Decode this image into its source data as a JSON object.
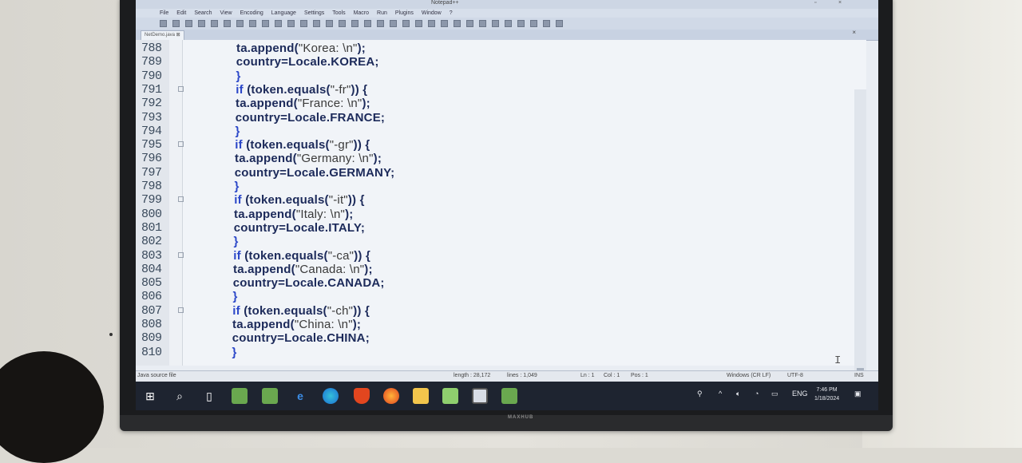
{
  "window": {
    "title": "Notepad++",
    "tab_label": "NetDemo.java",
    "restore_btn": "▫",
    "close_btn": "×"
  },
  "menu": [
    "File",
    "Edit",
    "Search",
    "View",
    "Encoding",
    "Language",
    "Settings",
    "Tools",
    "Macro",
    "Run",
    "Plugins",
    "Window",
    "?"
  ],
  "editor": {
    "lines": [
      {
        "n": "788",
        "code": [
          {
            "t": "ta.append(",
            "c": "p"
          },
          {
            "t": "\"Korea: \\n\"",
            "c": "s"
          },
          {
            "t": ");",
            "c": "p"
          }
        ]
      },
      {
        "n": "789",
        "code": [
          {
            "t": "country=Locale.KOREA;",
            "c": "p"
          }
        ]
      },
      {
        "n": "790",
        "code": [
          {
            "t": "}",
            "c": "k"
          }
        ]
      },
      {
        "n": "791",
        "code": [
          {
            "t": "if",
            "c": "k"
          },
          {
            "t": " (token.equals(",
            "c": "p"
          },
          {
            "t": "\"-fr\"",
            "c": "s"
          },
          {
            "t": ")) {",
            "c": "p"
          }
        ]
      },
      {
        "n": "792",
        "code": [
          {
            "t": "ta.append(",
            "c": "p"
          },
          {
            "t": "\"France: \\n\"",
            "c": "s"
          },
          {
            "t": ");",
            "c": "p"
          }
        ]
      },
      {
        "n": "793",
        "code": [
          {
            "t": "country=Locale.FRANCE;",
            "c": "p"
          }
        ]
      },
      {
        "n": "794",
        "code": [
          {
            "t": "}",
            "c": "k"
          }
        ]
      },
      {
        "n": "795",
        "code": [
          {
            "t": "if",
            "c": "k"
          },
          {
            "t": " (token.equals(",
            "c": "p"
          },
          {
            "t": "\"-gr\"",
            "c": "s"
          },
          {
            "t": ")) {",
            "c": "p"
          }
        ]
      },
      {
        "n": "796",
        "code": [
          {
            "t": "ta.append(",
            "c": "p"
          },
          {
            "t": "\"Germany: \\n\"",
            "c": "s"
          },
          {
            "t": ");",
            "c": "p"
          }
        ]
      },
      {
        "n": "797",
        "code": [
          {
            "t": "country=Locale.GERMANY;",
            "c": "p"
          }
        ]
      },
      {
        "n": "798",
        "code": [
          {
            "t": "}",
            "c": "k"
          }
        ]
      },
      {
        "n": "799",
        "code": [
          {
            "t": "if",
            "c": "k"
          },
          {
            "t": " (token.equals(",
            "c": "p"
          },
          {
            "t": "\"-it\"",
            "c": "s"
          },
          {
            "t": ")) {",
            "c": "p"
          }
        ]
      },
      {
        "n": "800",
        "code": [
          {
            "t": "ta.append(",
            "c": "p"
          },
          {
            "t": "\"Italy: \\n\"",
            "c": "s"
          },
          {
            "t": ");",
            "c": "p"
          }
        ]
      },
      {
        "n": "801",
        "code": [
          {
            "t": "country=Locale.ITALY;",
            "c": "p"
          }
        ]
      },
      {
        "n": "802",
        "code": [
          {
            "t": "}",
            "c": "k"
          }
        ]
      },
      {
        "n": "803",
        "code": [
          {
            "t": "if",
            "c": "k"
          },
          {
            "t": " (token.equals(",
            "c": "p"
          },
          {
            "t": "\"-ca\"",
            "c": "s"
          },
          {
            "t": ")) {",
            "c": "p"
          }
        ]
      },
      {
        "n": "804",
        "code": [
          {
            "t": "ta.append(",
            "c": "p"
          },
          {
            "t": "\"Canada: \\n\"",
            "c": "s"
          },
          {
            "t": ");",
            "c": "p"
          }
        ]
      },
      {
        "n": "805",
        "code": [
          {
            "t": "country=Locale.CANADA;",
            "c": "p"
          }
        ]
      },
      {
        "n": "806",
        "code": [
          {
            "t": "}",
            "c": "k"
          }
        ]
      },
      {
        "n": "807",
        "code": [
          {
            "t": "if",
            "c": "k"
          },
          {
            "t": " (token.equals(",
            "c": "p"
          },
          {
            "t": "\"-ch\"",
            "c": "s"
          },
          {
            "t": ")) {",
            "c": "p"
          }
        ]
      },
      {
        "n": "808",
        "code": [
          {
            "t": "ta.append(",
            "c": "p"
          },
          {
            "t": "\"China: \\n\"",
            "c": "s"
          },
          {
            "t": ");",
            "c": "p"
          }
        ]
      },
      {
        "n": "809",
        "code": [
          {
            "t": "country=Locale.CHINA;",
            "c": "p"
          }
        ]
      },
      {
        "n": "810",
        "code": [
          {
            "t": "}",
            "c": "k"
          }
        ]
      }
    ],
    "text_cursor_icon": "I-beam-cursor"
  },
  "status": {
    "file_type": "Java source file",
    "length": "length : 28,172",
    "lines": "lines : 1,049",
    "ln": "Ln : 1",
    "col": "Col : 1",
    "pos": "Pos : 1",
    "eol": "Windows (CR LF)",
    "encoding": "UTF-8",
    "mode": "INS"
  },
  "taskbar": {
    "language": "ENG",
    "time": "7:46 PM",
    "date": "1/18/2024",
    "icons": [
      "windows-start-icon",
      "search-icon",
      "task-view-icon",
      "notepad-app-icon",
      "notepad-app-icon-2",
      "ie-icon",
      "edge-icon",
      "brave-icon",
      "firefox-icon",
      "file-explorer-icon",
      "notepad-pp-icon",
      "terminal-icon",
      "notepad-app-icon-3"
    ]
  },
  "monitor_brand": "MAXHUB",
  "colors": {
    "keyword": "#2a46c8",
    "code": "#1c2a5a",
    "taskbar": "#1e2430"
  }
}
